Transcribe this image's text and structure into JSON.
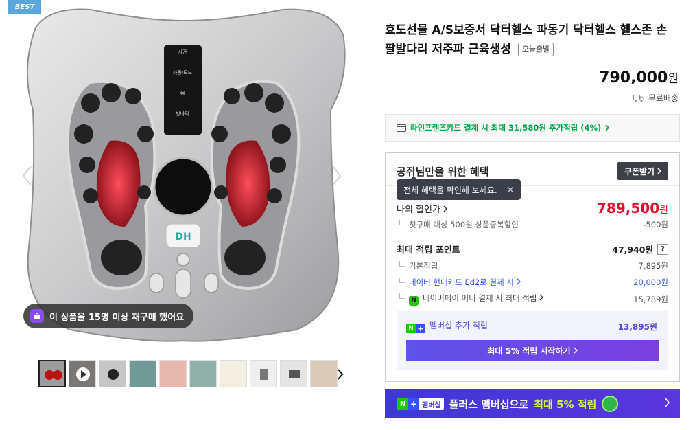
{
  "gallery": {
    "best_badge": "BEST",
    "rebuy_text": "이 상품을 15명 이상 재구매 했어요",
    "device_panel": [
      "시간",
      "자동/모드",
      "强",
      "방바닥"
    ],
    "device_logo": "DH",
    "thumbnail_count": 10
  },
  "product": {
    "title": "효도선물 A/S보증서 닥터헬스 파동기 닥터헬스 헬스존 손팔발다리 저주파 근육생성",
    "today_badge": "오늘출발",
    "price": "790,000",
    "price_unit": "원",
    "shipping": "무료배송"
  },
  "card_banner": {
    "text": "라인프렌즈카드 결제 시 최대 31,580원 추가적립 (4%)"
  },
  "benefits": {
    "title": "공쥐님만을 위한 혜택",
    "coupon_button": "쿠폰받기",
    "tooltip": "전체 혜택을 확인해 보세요.",
    "my_price_label": "나의 할인가",
    "my_price": "789,500",
    "my_price_unit": "원",
    "first_purchase_label": "첫구매 대상 500원 상품중복할인",
    "first_purchase_value": "-500원",
    "max_points_label": "최대 적립 포인트",
    "max_points_value": "47,940원",
    "help": "?",
    "basic_label": "기본적립",
    "basic_value": "7,895원",
    "naver_card_label": "네이버 현대카드 Ed2로 결제 시",
    "naver_card_value": "20,000원",
    "npay_money_label": "네이버페이 머니 결제 시 최대 적립",
    "npay_money_value": "15,789원",
    "npay_icon": "N",
    "membership_label": "멤버십 추가 적립",
    "membership_value": "13,895원",
    "membership_button": "최대 5% 적립 시작하기"
  },
  "plus_banner": {
    "tag": "멤버십",
    "text_prefix": "플러스 멤버십으로",
    "text_highlight": "최대 5% 적립"
  },
  "colors": {
    "accent_green": "#05a74b",
    "sale_red": "#e0102c",
    "link_blue": "#3656d7",
    "membership_purple": "#5a46d6"
  }
}
